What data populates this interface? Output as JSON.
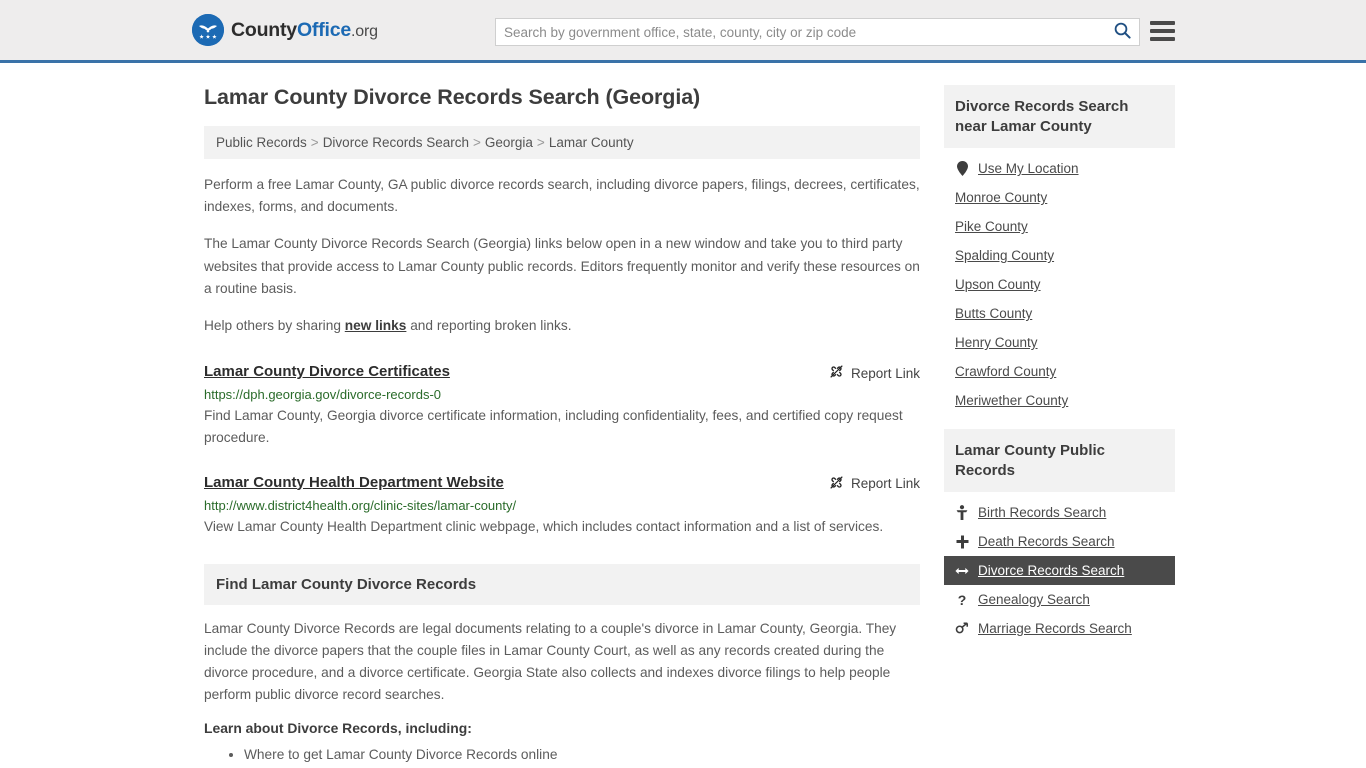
{
  "header": {
    "logo": {
      "text_a": "County",
      "text_b": "Office",
      "tld": ".org",
      "icon": "eagle-stars-seal"
    },
    "search": {
      "placeholder": "Search by government office, state, county, city or zip code",
      "value": "",
      "search_icon": "search-icon"
    },
    "menu_icon": "hamburger-menu-icon",
    "accent_color": "#3a72a8"
  },
  "main": {
    "title": "Lamar County Divorce Records Search (Georgia)",
    "breadcrumb": [
      "Public Records",
      "Divorce Records Search",
      "Georgia",
      "Lamar County"
    ],
    "breadcrumb_separator": ">",
    "intro_1": "Perform a free Lamar County, GA public divorce records search, including divorce papers, filings, decrees, certificates, indexes, forms, and documents.",
    "intro_2": "The Lamar County Divorce Records Search (Georgia) links below open in a new window and take you to third party websites that provide access to Lamar County public records. Editors frequently monitor and verify these resources on a routine basis.",
    "help_prefix": "Help others by sharing ",
    "help_link": "new links",
    "help_suffix": " and reporting broken links.",
    "report_link_label": "Report Link",
    "report_link_icon": "broken-link-icon",
    "results": [
      {
        "title": "Lamar County Divorce Certificates",
        "url": "https://dph.georgia.gov/divorce-records-0",
        "description": "Find Lamar County, Georgia divorce certificate information, including confidentiality, fees, and certified copy request procedure."
      },
      {
        "title": "Lamar County Health Department Website",
        "url": "http://www.district4health.org/clinic-sites/lamar-county/",
        "description": "View Lamar County Health Department clinic webpage, which includes contact information and a list of services."
      }
    ],
    "section": {
      "heading": "Find Lamar County Divorce Records",
      "paragraph": "Lamar County Divorce Records are legal documents relating to a couple's divorce in Lamar County, Georgia. They include the divorce papers that the couple files in Lamar County Court, as well as any records created during the divorce procedure, and a divorce certificate. Georgia State also collects and indexes divorce filings to help people perform public divorce record searches.",
      "learn_heading": "Learn about Divorce Records, including:",
      "learn_items": [
        "Where to get Lamar County Divorce Records online"
      ]
    }
  },
  "sidebar": {
    "nearby": {
      "title": "Divorce Records Search near Lamar County",
      "items": [
        {
          "label": "Use My Location",
          "icon": "map-pin-icon"
        },
        {
          "label": "Monroe County",
          "icon": ""
        },
        {
          "label": "Pike County",
          "icon": ""
        },
        {
          "label": "Spalding County",
          "icon": ""
        },
        {
          "label": "Upson County",
          "icon": ""
        },
        {
          "label": "Butts County",
          "icon": ""
        },
        {
          "label": "Henry County",
          "icon": ""
        },
        {
          "label": "Crawford County",
          "icon": ""
        },
        {
          "label": "Meriwether County",
          "icon": ""
        }
      ]
    },
    "public_records": {
      "title": "Lamar County Public Records",
      "active_index": 2,
      "active_color": "#4a4a4a",
      "items": [
        {
          "label": "Birth Records Search",
          "icon": "baby-icon",
          "glyph": "Ɣ"
        },
        {
          "label": "Death Records Search",
          "icon": "cross-icon",
          "glyph": "✚"
        },
        {
          "label": "Divorce Records Search",
          "icon": "left-right-arrow-icon",
          "glyph": "↔"
        },
        {
          "label": "Genealogy Search",
          "icon": "question-mark-icon",
          "glyph": "?"
        },
        {
          "label": "Marriage Records Search",
          "icon": "male-female-icon",
          "glyph": "⚥"
        }
      ]
    }
  }
}
